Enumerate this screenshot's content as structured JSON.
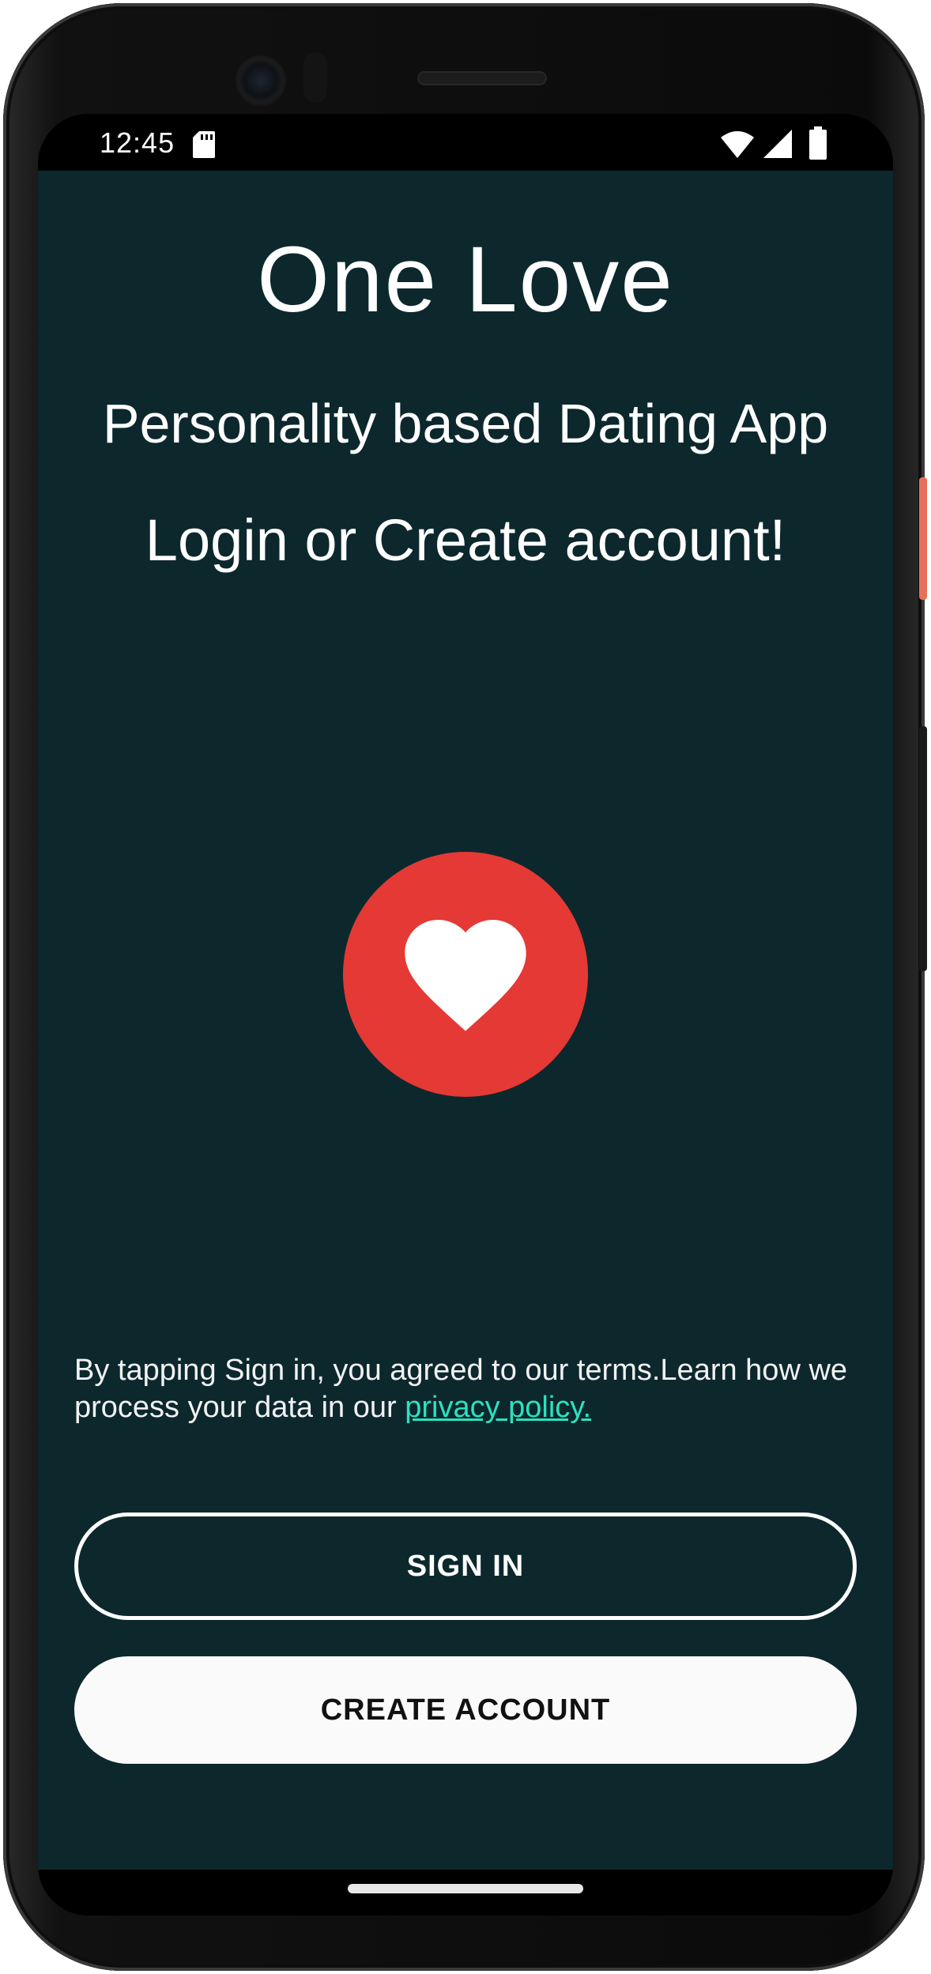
{
  "status_bar": {
    "time": "12:45",
    "icons": [
      "sd-card-icon",
      "wifi-icon",
      "cell-signal-icon",
      "battery-icon"
    ]
  },
  "app": {
    "title": "One Love",
    "subtitle": "Personality based Dating App",
    "prompt": "Login or Create account!",
    "logo_icon": "heart-icon",
    "terms_text": "By tapping Sign in, you agreed to our terms.Learn how we process your data in our ",
    "privacy_link": "privacy policy.",
    "sign_in_label": "SIGN IN",
    "create_account_label": "CREATE ACCOUNT"
  },
  "colors": {
    "background": "#0c282d",
    "heart_badge": "#e53935",
    "link": "#2ee0c0",
    "primary_button": "#fafafa"
  }
}
